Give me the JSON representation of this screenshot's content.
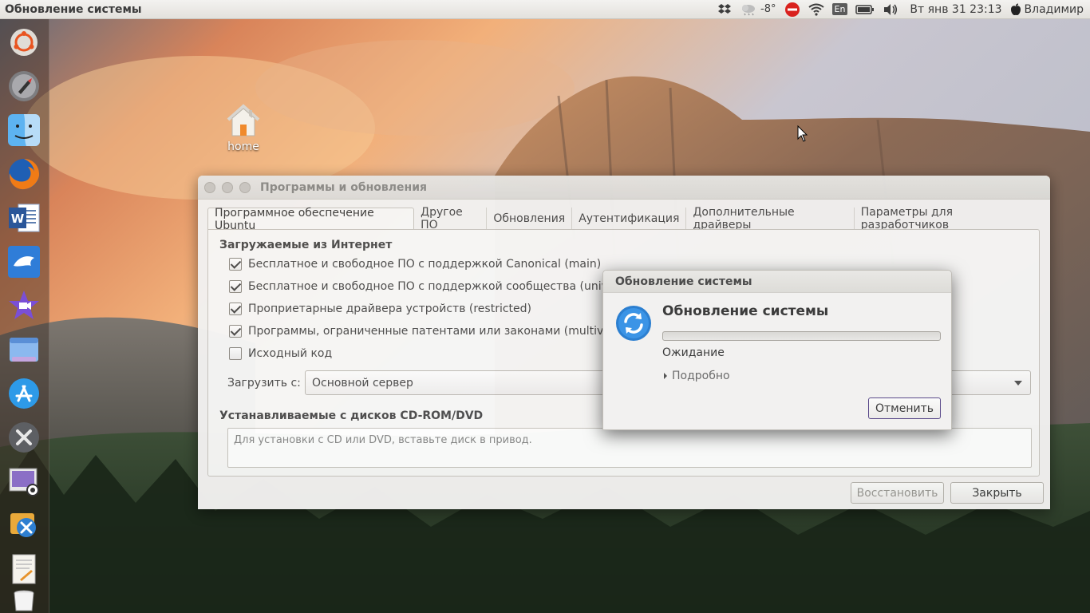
{
  "top_panel": {
    "app_title": "Обновление системы",
    "temperature": "-8°",
    "language": "En",
    "clock": "Вт янв 31 23:13",
    "user": "Владимир",
    "icons": [
      "dropbox-icon",
      "weather-icon",
      "no-entry-icon",
      "wifi-icon",
      "keyboard-layout-icon",
      "battery-icon",
      "volume-icon",
      "apple-icon"
    ]
  },
  "launcher": {
    "items": [
      "ubuntu-dash-icon",
      "launchpad-icon",
      "finder-icon",
      "firefox-icon",
      "word-icon",
      "messenger-icon",
      "imovie-icon",
      "files-icon",
      "app-store-icon",
      "system-tools-icon",
      "screenshot-icon",
      "xcode-tools-icon",
      "text-editor-icon",
      "trash-icon"
    ]
  },
  "desktop": {
    "home_label": "home"
  },
  "main_window": {
    "title": "Программы и обновления",
    "tabs": [
      {
        "label": "Программное обеспечение Ubuntu",
        "active": true
      },
      {
        "label": "Другое ПО",
        "active": false
      },
      {
        "label": "Обновления",
        "active": false
      },
      {
        "label": "Аутентификация",
        "active": false
      },
      {
        "label": "Дополнительные драйверы",
        "active": false
      },
      {
        "label": "Параметры для разработчиков",
        "active": false
      }
    ],
    "internet_section_title": "Загружаемые из Интернет",
    "sources": [
      {
        "label": "Бесплатное и свободное ПО с поддержкой Canonical (main)",
        "checked": true
      },
      {
        "label": "Бесплатное и свободное ПО с поддержкой сообщества (univers",
        "checked": true
      },
      {
        "label": "Проприетарные драйвера устройств (restricted)",
        "checked": true
      },
      {
        "label": "Программы, ограниченные патентами или законами (multivers",
        "checked": true
      },
      {
        "label": "Исходный код",
        "checked": false
      }
    ],
    "download_from_label": "Загрузить с:",
    "download_from_value": "Основной сервер",
    "cdrom_section_title": "Устанавливаемые с дисков CD-ROM/DVD",
    "cdrom_hint": "Для установки с CD или DVD, вставьте диск в привод.",
    "revert_button": "Восстановить",
    "close_button": "Закрыть"
  },
  "progress_dialog": {
    "title": "Обновление системы",
    "heading": "Обновление системы",
    "progress": 0,
    "status": "Ожидание",
    "details_label": "Подробно",
    "cancel_button": "Отменить",
    "accent_color": "#e26f3e"
  }
}
